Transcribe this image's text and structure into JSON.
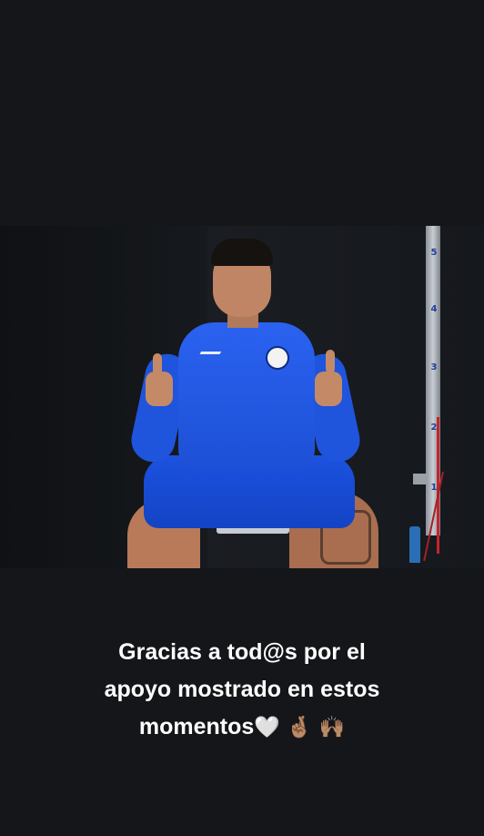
{
  "story": {
    "caption": {
      "line1": "Gracias a tod@s por el",
      "line2": "apoyo mostrado en estos",
      "line3": "momentos",
      "emojis": [
        "🤍",
        "🤞🏽",
        "🙌🏽"
      ]
    },
    "photo": {
      "pole_marks": [
        "5",
        "4",
        "3",
        "2",
        "1"
      ]
    }
  },
  "colors": {
    "background": "#141619",
    "jersey": "#1d50d6",
    "caption_text": "#ffffff"
  }
}
